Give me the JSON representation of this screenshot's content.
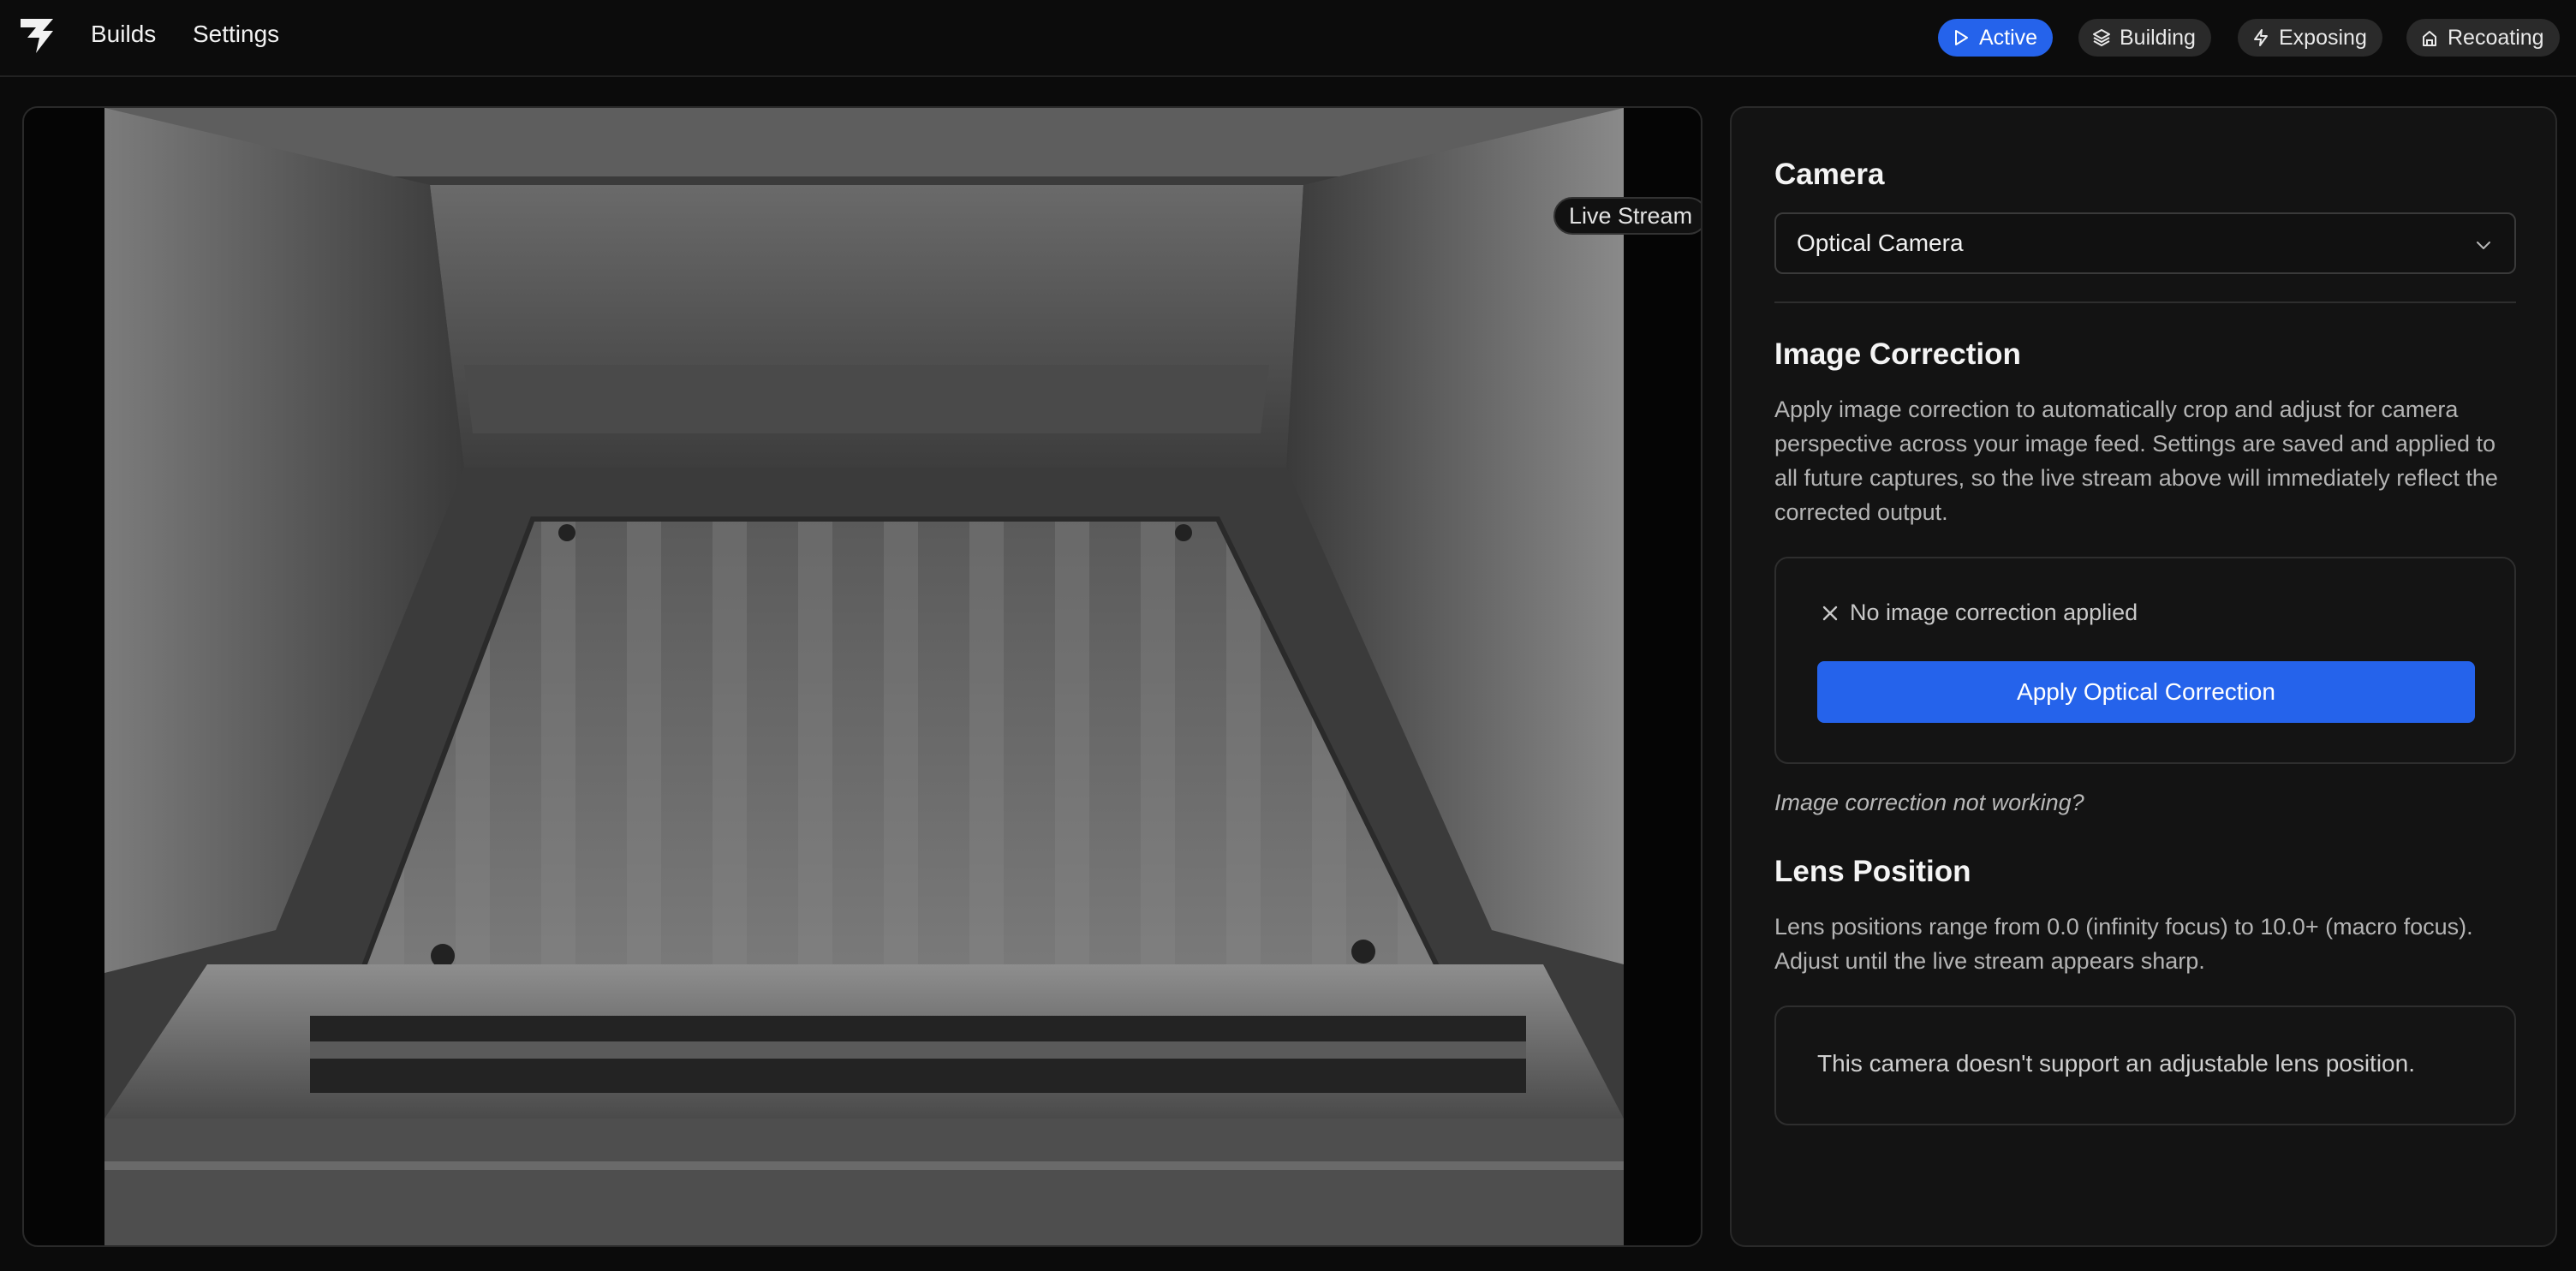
{
  "nav": {
    "builds_label": "Builds",
    "settings_label": "Settings"
  },
  "status_pills": {
    "active": "Active",
    "building": "Building",
    "exposing": "Exposing",
    "recoating": "Recoating"
  },
  "stream": {
    "badge": "Live Stream"
  },
  "camera": {
    "heading": "Camera",
    "selected": "Optical Camera"
  },
  "image_correction": {
    "heading": "Image Correction",
    "description": "Apply image correction to automatically crop and adjust for camera perspective across your image feed. Settings are saved and applied to all future captures, so the live stream above will immediately reflect the corrected output.",
    "status": "No image correction applied",
    "apply_button": "Apply Optical Correction",
    "help_link": "Image correction not working?"
  },
  "lens_position": {
    "heading": "Lens Position",
    "description": "Lens positions range from 0.0 (infinity focus) to 10.0+ (macro focus). Adjust until the live stream appears sharp.",
    "message": "This camera doesn't support an adjustable lens position."
  },
  "colors": {
    "accent": "#2563eb",
    "background": "#0b0b0b",
    "panel": "#131313"
  },
  "icons": {
    "logo": "brand-logo-icon",
    "active": "play-icon",
    "building": "layers-icon",
    "exposing": "lightning-icon",
    "recoating": "recoater-icon",
    "select": "chevron-down-icon",
    "status": "x-icon"
  }
}
